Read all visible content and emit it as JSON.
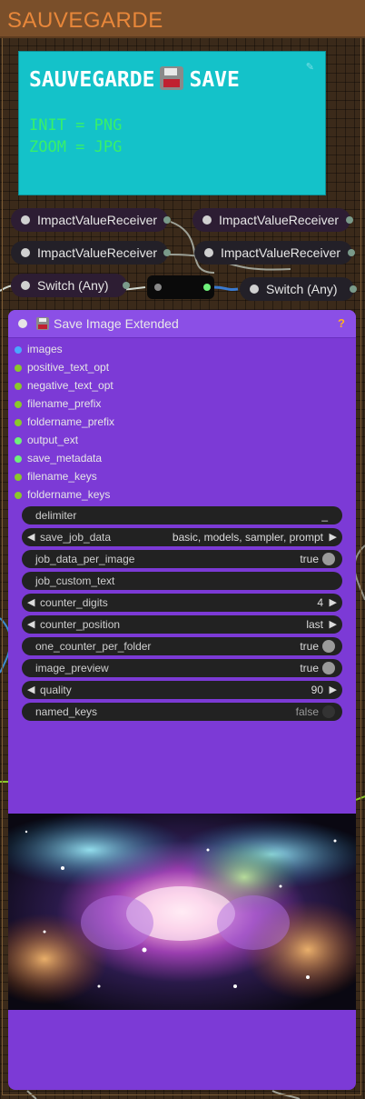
{
  "group": {
    "title": "SAUVEGARDE"
  },
  "note": {
    "title_left": "SAUVEGARDE",
    "title_right": "SAVE",
    "line1": "INIT = PNG",
    "line2": "ZOOM = JPG",
    "edit_icon": "edit-icon"
  },
  "small_nodes": [
    {
      "label": "ImpactValueReceiver"
    },
    {
      "label": "ImpactValueReceiver"
    },
    {
      "label": "ImpactValueReceiver"
    },
    {
      "label": "ImpactValueReceiver"
    },
    {
      "label": "Switch (Any)"
    },
    {
      "label": "Switch (Any)"
    }
  ],
  "save_node": {
    "title": "Save Image Extended",
    "help": "?",
    "inputs": [
      {
        "label": "images",
        "color": "#4aa8ff"
      },
      {
        "label": "positive_text_opt",
        "color": "#8ac82a"
      },
      {
        "label": "negative_text_opt",
        "color": "#8ac82a"
      },
      {
        "label": "filename_prefix",
        "color": "#8ac82a"
      },
      {
        "label": "foldername_prefix",
        "color": "#8ac82a"
      },
      {
        "label": "output_ext",
        "color": "#6ef07a"
      },
      {
        "label": "save_metadata",
        "color": "#6ef07a"
      },
      {
        "label": "filename_keys",
        "color": "#8ac82a"
      },
      {
        "label": "foldername_keys",
        "color": "#8ac82a"
      }
    ],
    "widgets": {
      "delimiter": {
        "label": "delimiter",
        "value": "_"
      },
      "save_job_data": {
        "label": "save_job_data",
        "value": "basic, models, sampler, prompt"
      },
      "job_data_per_image": {
        "label": "job_data_per_image",
        "value": "true"
      },
      "job_custom_text": {
        "label": "job_custom_text",
        "value": ""
      },
      "counter_digits": {
        "label": "counter_digits",
        "value": "4"
      },
      "counter_position": {
        "label": "counter_position",
        "value": "last"
      },
      "one_counter_per_folder": {
        "label": "one_counter_per_folder",
        "value": "true"
      },
      "image_preview": {
        "label": "image_preview",
        "value": "true"
      },
      "quality": {
        "label": "quality",
        "value": "90"
      },
      "named_keys": {
        "label": "named_keys",
        "value": "false"
      }
    }
  },
  "colors": {
    "node": "#7c3ad6",
    "note": "#14c2c9",
    "group_title": "#e8873a"
  }
}
